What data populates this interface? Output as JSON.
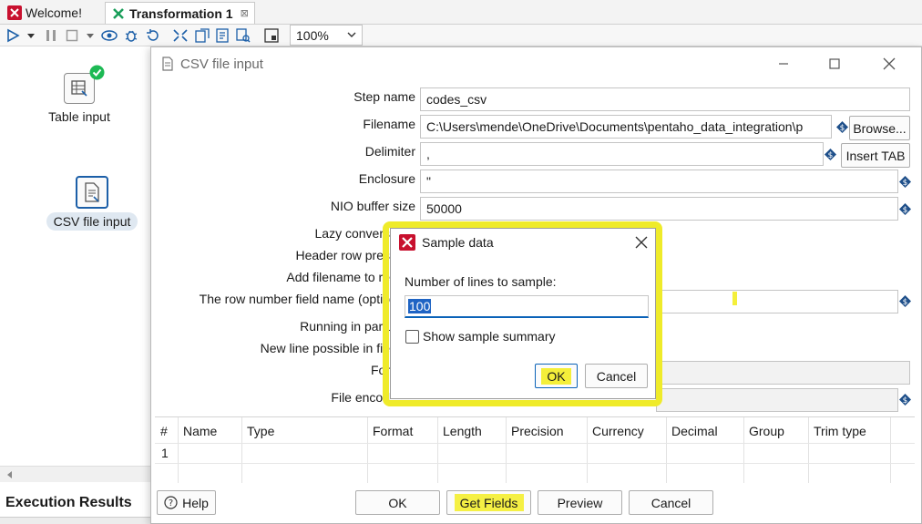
{
  "tabs": [
    {
      "label": "Welcome!",
      "active": false
    },
    {
      "label": "Transformation 1",
      "active": true
    }
  ],
  "toolbar": {
    "zoom": "100%"
  },
  "canvas": {
    "steps": [
      {
        "label": "Table input",
        "status": "ok",
        "icon": "table-input-icon"
      },
      {
        "label": "CSV file input",
        "selected": true,
        "icon": "csv-file-icon"
      }
    ],
    "execution_results_label": "Execution Results"
  },
  "csv_dialog": {
    "title": "CSV file input",
    "labels": {
      "step_name": "Step name",
      "filename": "Filename",
      "delimiter": "Delimiter",
      "enclosure": "Enclosure",
      "nio_buffer": "NIO buffer size",
      "lazy_conversion": "Lazy convers",
      "header_row": "Header row pres",
      "add_filename": "Add filename to re",
      "row_number_field": "The row number field name (optio",
      "running_parallel": "Running in para",
      "new_line": "New line possible in fie",
      "format": "For",
      "file_encoding": "File encod"
    },
    "values": {
      "step_name": "codes_csv",
      "filename": "C:\\Users\\mende\\OneDrive\\Documents\\pentaho_data_integration\\p",
      "delimiter": ",",
      "enclosure": "\"",
      "nio_buffer": "50000",
      "row_number_field": "",
      "format": "",
      "file_encoding": ""
    },
    "buttons": {
      "browse": "Browse...",
      "insert_tab": "Insert TAB",
      "help": "Help",
      "ok": "OK",
      "get_fields": "Get Fields",
      "preview": "Preview",
      "cancel": "Cancel"
    },
    "table": {
      "columns": [
        "#",
        "Name",
        "Type",
        "Format",
        "Length",
        "Precision",
        "Currency",
        "Decimal",
        "Group",
        "Trim type"
      ],
      "rows": [
        [
          "1",
          "",
          "",
          "",
          "",
          "",
          "",
          "",
          "",
          ""
        ]
      ]
    }
  },
  "sample_dialog": {
    "title": "Sample data",
    "lines_label": "Number of lines to sample:",
    "lines_value": "100",
    "summary_label": "Show sample summary",
    "summary_checked": false,
    "ok": "OK",
    "cancel": "Cancel"
  },
  "colors": {
    "highlight": "#efeb2a",
    "selection": "#1f64c4",
    "accent_green": "#1db954",
    "accent_blue": "#1c5fa8",
    "pentaho_red": "#c8102e"
  }
}
